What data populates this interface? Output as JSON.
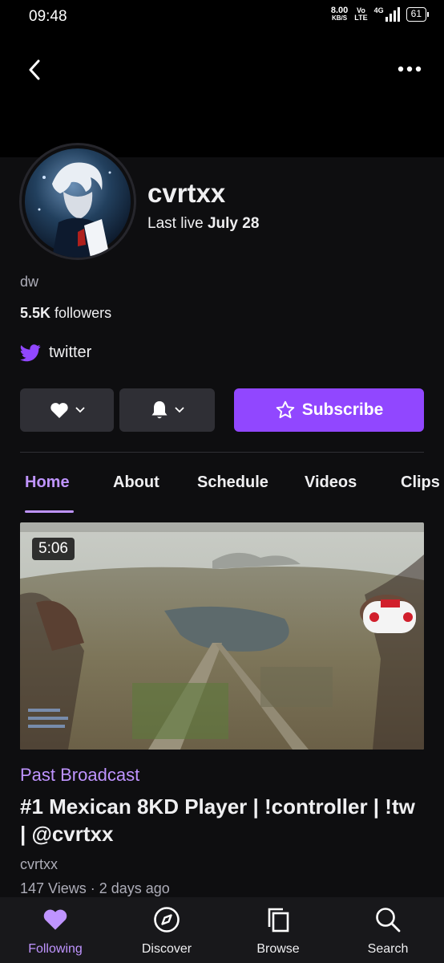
{
  "status_bar": {
    "time": "09:48",
    "net_speed_value": "8.00",
    "net_speed_unit": "KB/S",
    "volte_top": "Vo",
    "volte_bottom": "LTE",
    "network": "4G",
    "battery": "61"
  },
  "channel": {
    "name": "cvrtxx",
    "last_live_prefix": "Last live",
    "last_live_date": "July 28",
    "bio": "dw",
    "followers_count": "5.5K",
    "followers_label": "followers",
    "social_link": "twitter"
  },
  "actions": {
    "subscribe_label": "Subscribe"
  },
  "tabs": [
    {
      "label": "Home",
      "active": true
    },
    {
      "label": "About"
    },
    {
      "label": "Schedule"
    },
    {
      "label": "Videos"
    },
    {
      "label": "Clips"
    }
  ],
  "video": {
    "duration": "5:06",
    "type_label": "Past Broadcast",
    "title": "#1 Mexican 8KD Player | !controller | !tw | @cvrtxx",
    "channel": "cvrtxx",
    "meta": "147 Views · 2 days ago"
  },
  "bottom_nav": [
    {
      "label": "Following",
      "icon": "heart-icon",
      "active": true
    },
    {
      "label": "Discover",
      "icon": "compass-icon"
    },
    {
      "label": "Browse",
      "icon": "browse-icon"
    },
    {
      "label": "Search",
      "icon": "search-icon"
    }
  ],
  "colors": {
    "accent": "#9147ff",
    "accent_light": "#bf94ff",
    "background": "#0e0e10",
    "button_gray": "#2f2f35",
    "nav_background": "#18181b"
  }
}
